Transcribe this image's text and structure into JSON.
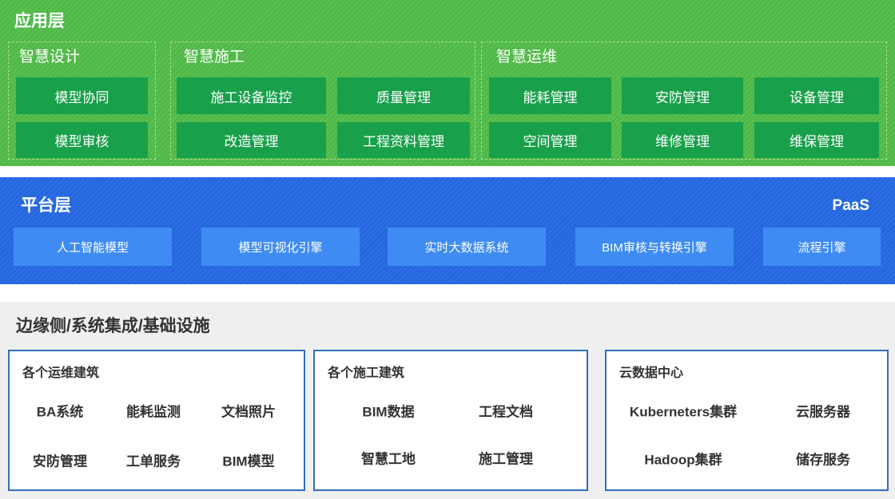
{
  "application_layer": {
    "title": "应用层",
    "groups": [
      {
        "label": "智慧设计",
        "items": [
          "模型协同",
          "模型审核"
        ]
      },
      {
        "label": "智慧施工",
        "items": [
          "施工设备监控",
          "质量管理",
          "改造管理",
          "工程资料管理"
        ]
      },
      {
        "label": "智慧运维",
        "items": [
          "能耗管理",
          "安防管理",
          "设备管理",
          "空间管理",
          "维修管理",
          "维保管理"
        ]
      }
    ]
  },
  "platform_layer": {
    "title": "平台层",
    "tag": "PaaS",
    "items": [
      "人工智能模型",
      "模型可视化引擎",
      "实时大数据系统",
      "BIM审核与转换引擎",
      "流程引擎"
    ]
  },
  "infrastructure_layer": {
    "title": "边缘侧/系统集成/基础设施",
    "groups": [
      {
        "label": "各个运维建筑",
        "items": [
          "BA系统",
          "能耗监测",
          "文档照片",
          "安防管理",
          "工单服务",
          "BIM模型"
        ]
      },
      {
        "label": "各个施工建筑",
        "items": [
          "BIM数据",
          "工程文档",
          "智慧工地",
          "施工管理"
        ]
      },
      {
        "label": "云数据中心",
        "items": [
          "Kuberneters集群",
          "云服务器",
          "Hadoop集群",
          "储存服务"
        ]
      }
    ]
  },
  "colors": {
    "green_band": "#4FB848",
    "green_stripe": "#5DC154",
    "green_button": "#19A04B",
    "green_dash": "#A6DC8F",
    "blue_band": "#2566DE",
    "blue_stripe": "#3071E7",
    "blue_box": "#3E8CF3",
    "gray_band": "#EFEFEF",
    "box_border": "#2F6FBA",
    "text_dark": "#333333"
  }
}
